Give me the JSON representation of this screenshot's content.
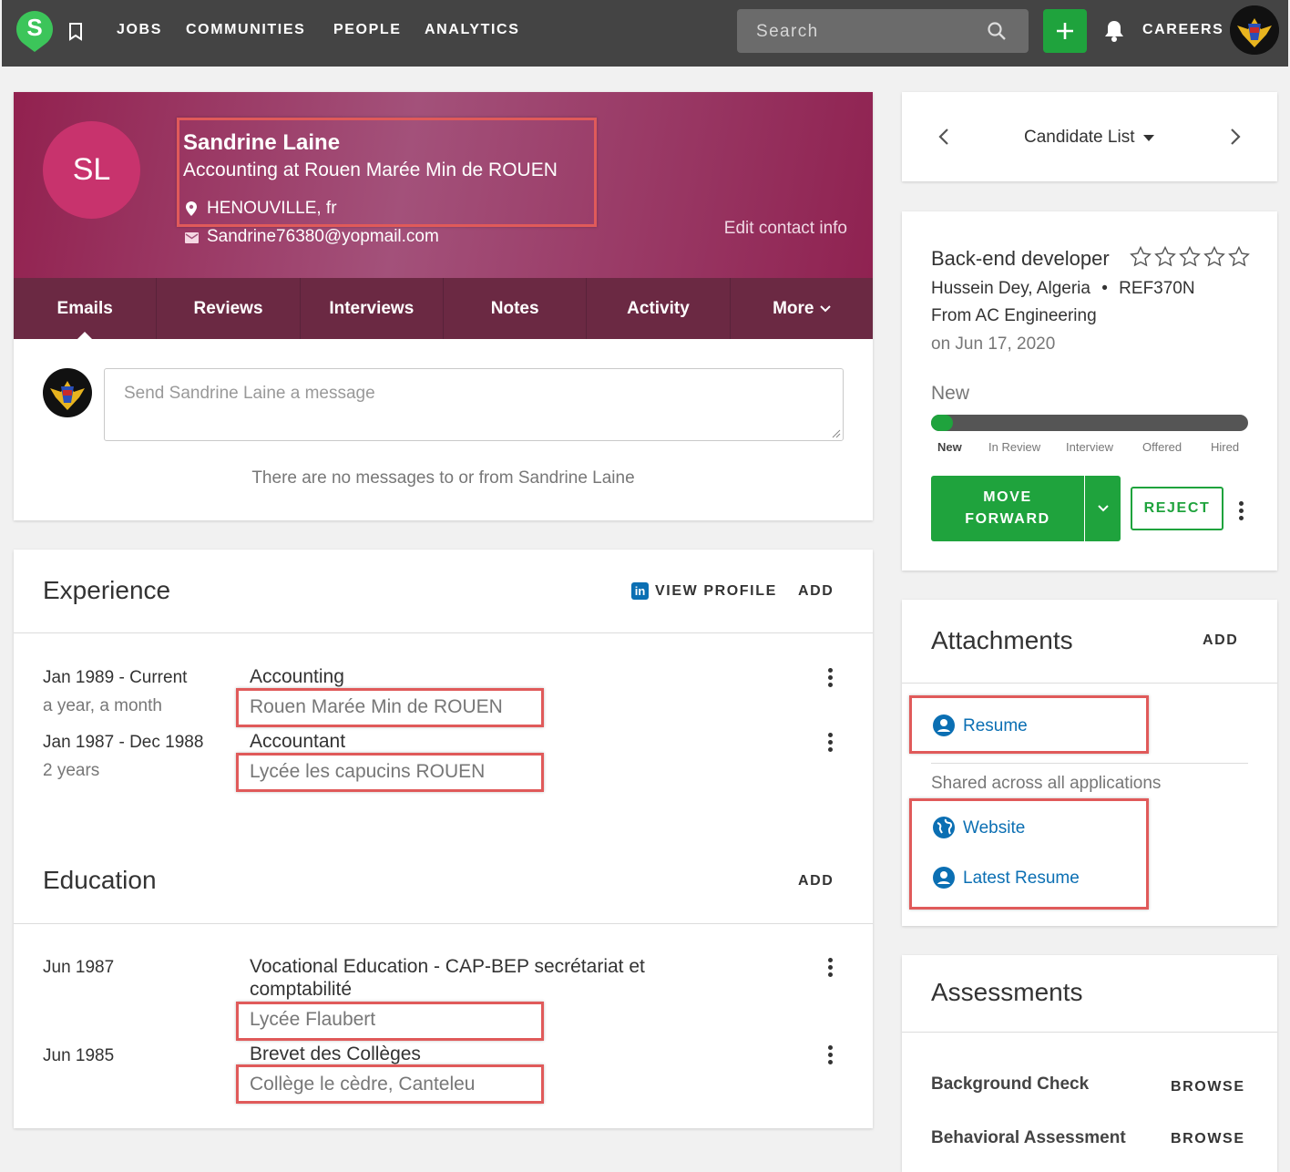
{
  "topbar": {
    "logo_letter": "S",
    "nav": [
      "JOBS",
      "COMMUNITIES",
      "PEOPLE",
      "ANALYTICS"
    ],
    "search_placeholder": "Search",
    "careers": "CAREERS"
  },
  "profile": {
    "initials": "SL",
    "name": "Sandrine Laine",
    "position": "Accounting at Rouen Marée Min de ROUEN",
    "location": "HENOUVILLE, fr",
    "email": "Sandrine76380@yopmail.com",
    "edit_contact": "Edit contact info",
    "tabs": [
      "Emails",
      "Reviews",
      "Interviews",
      "Notes",
      "Activity",
      "More"
    ]
  },
  "messages": {
    "placeholder": "Send Sandrine Laine a message",
    "empty": "There are no messages to or from Sandrine Laine"
  },
  "experience": {
    "title": "Experience",
    "view_profile": "VIEW PROFILE",
    "add": "ADD",
    "items": [
      {
        "dates": "Jan 1989 - Current",
        "duration": "a year, a month",
        "title": "Accounting",
        "org": "Rouen Marée Min de ROUEN"
      },
      {
        "dates": "Jan 1987 - Dec 1988",
        "duration": "2 years",
        "title": "Accountant",
        "org": "Lycée les capucins ROUEN"
      }
    ]
  },
  "education": {
    "title": "Education",
    "add": "ADD",
    "items": [
      {
        "date": "Jun 1987",
        "title": "Vocational Education - CAP-BEP secrétariat et comptabilité",
        "org": "Lycée Flaubert"
      },
      {
        "date": "Jun 1985",
        "title": "Brevet des Collèges",
        "org": "Collège le cèdre, Canteleu"
      }
    ]
  },
  "candidate_nav": {
    "label": "Candidate List"
  },
  "job": {
    "title": "Back-end developer",
    "rating": 0,
    "location": "Hussein Dey, Algeria",
    "ref": "REF370N",
    "source": "From AC Engineering",
    "date": "on Jun 17, 2020",
    "stage": "New",
    "stages": [
      "New",
      "In Review",
      "Interview",
      "Offered",
      "Hired"
    ],
    "move_forward": "MOVE FORWARD",
    "reject": "REJECT",
    "accent": "#1fa33d"
  },
  "attachments": {
    "title": "Attachments",
    "add": "ADD",
    "resume": "Resume",
    "shared": "Shared across all applications",
    "website": "Website",
    "latest_resume": "Latest Resume"
  },
  "assessments": {
    "title": "Assessments",
    "items": [
      {
        "name": "Background Check",
        "action": "BROWSE"
      },
      {
        "name": "Behavioral Assessment",
        "action": "BROWSE"
      }
    ]
  }
}
